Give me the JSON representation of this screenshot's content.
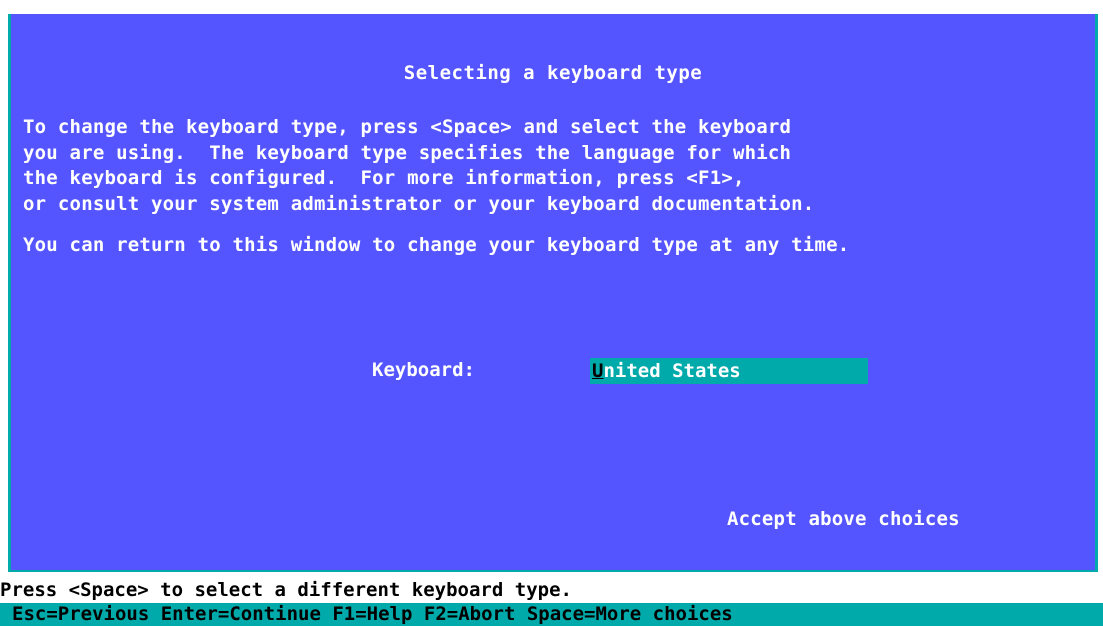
{
  "window": {
    "title": "Selecting a keyboard type",
    "paragraph1": "To change the keyboard type, press <Space> and select the keyboard\nyou are using.  The keyboard type specifies the language for which\nthe keyboard is configured.  For more information, press <F1>,\nor consult your system administrator or your keyboard documentation.",
    "paragraph2": "You can return to this window to change your keyboard type at any time."
  },
  "keyboard": {
    "label": "Keyboard:",
    "value_first": "U",
    "value_rest": "nited States"
  },
  "accept_label": "Accept above choices",
  "hint": "Press <Space> to select a different keyboard type.",
  "keybar": {
    "items": [
      "Esc=Previous",
      "Enter=Continue",
      "F1=Help",
      "F2=Abort",
      "Space=More choices"
    ]
  },
  "colors": {
    "window_bg": "#5555ff",
    "accent_cyan": "#00aaaa",
    "text_white": "#ffffff"
  }
}
